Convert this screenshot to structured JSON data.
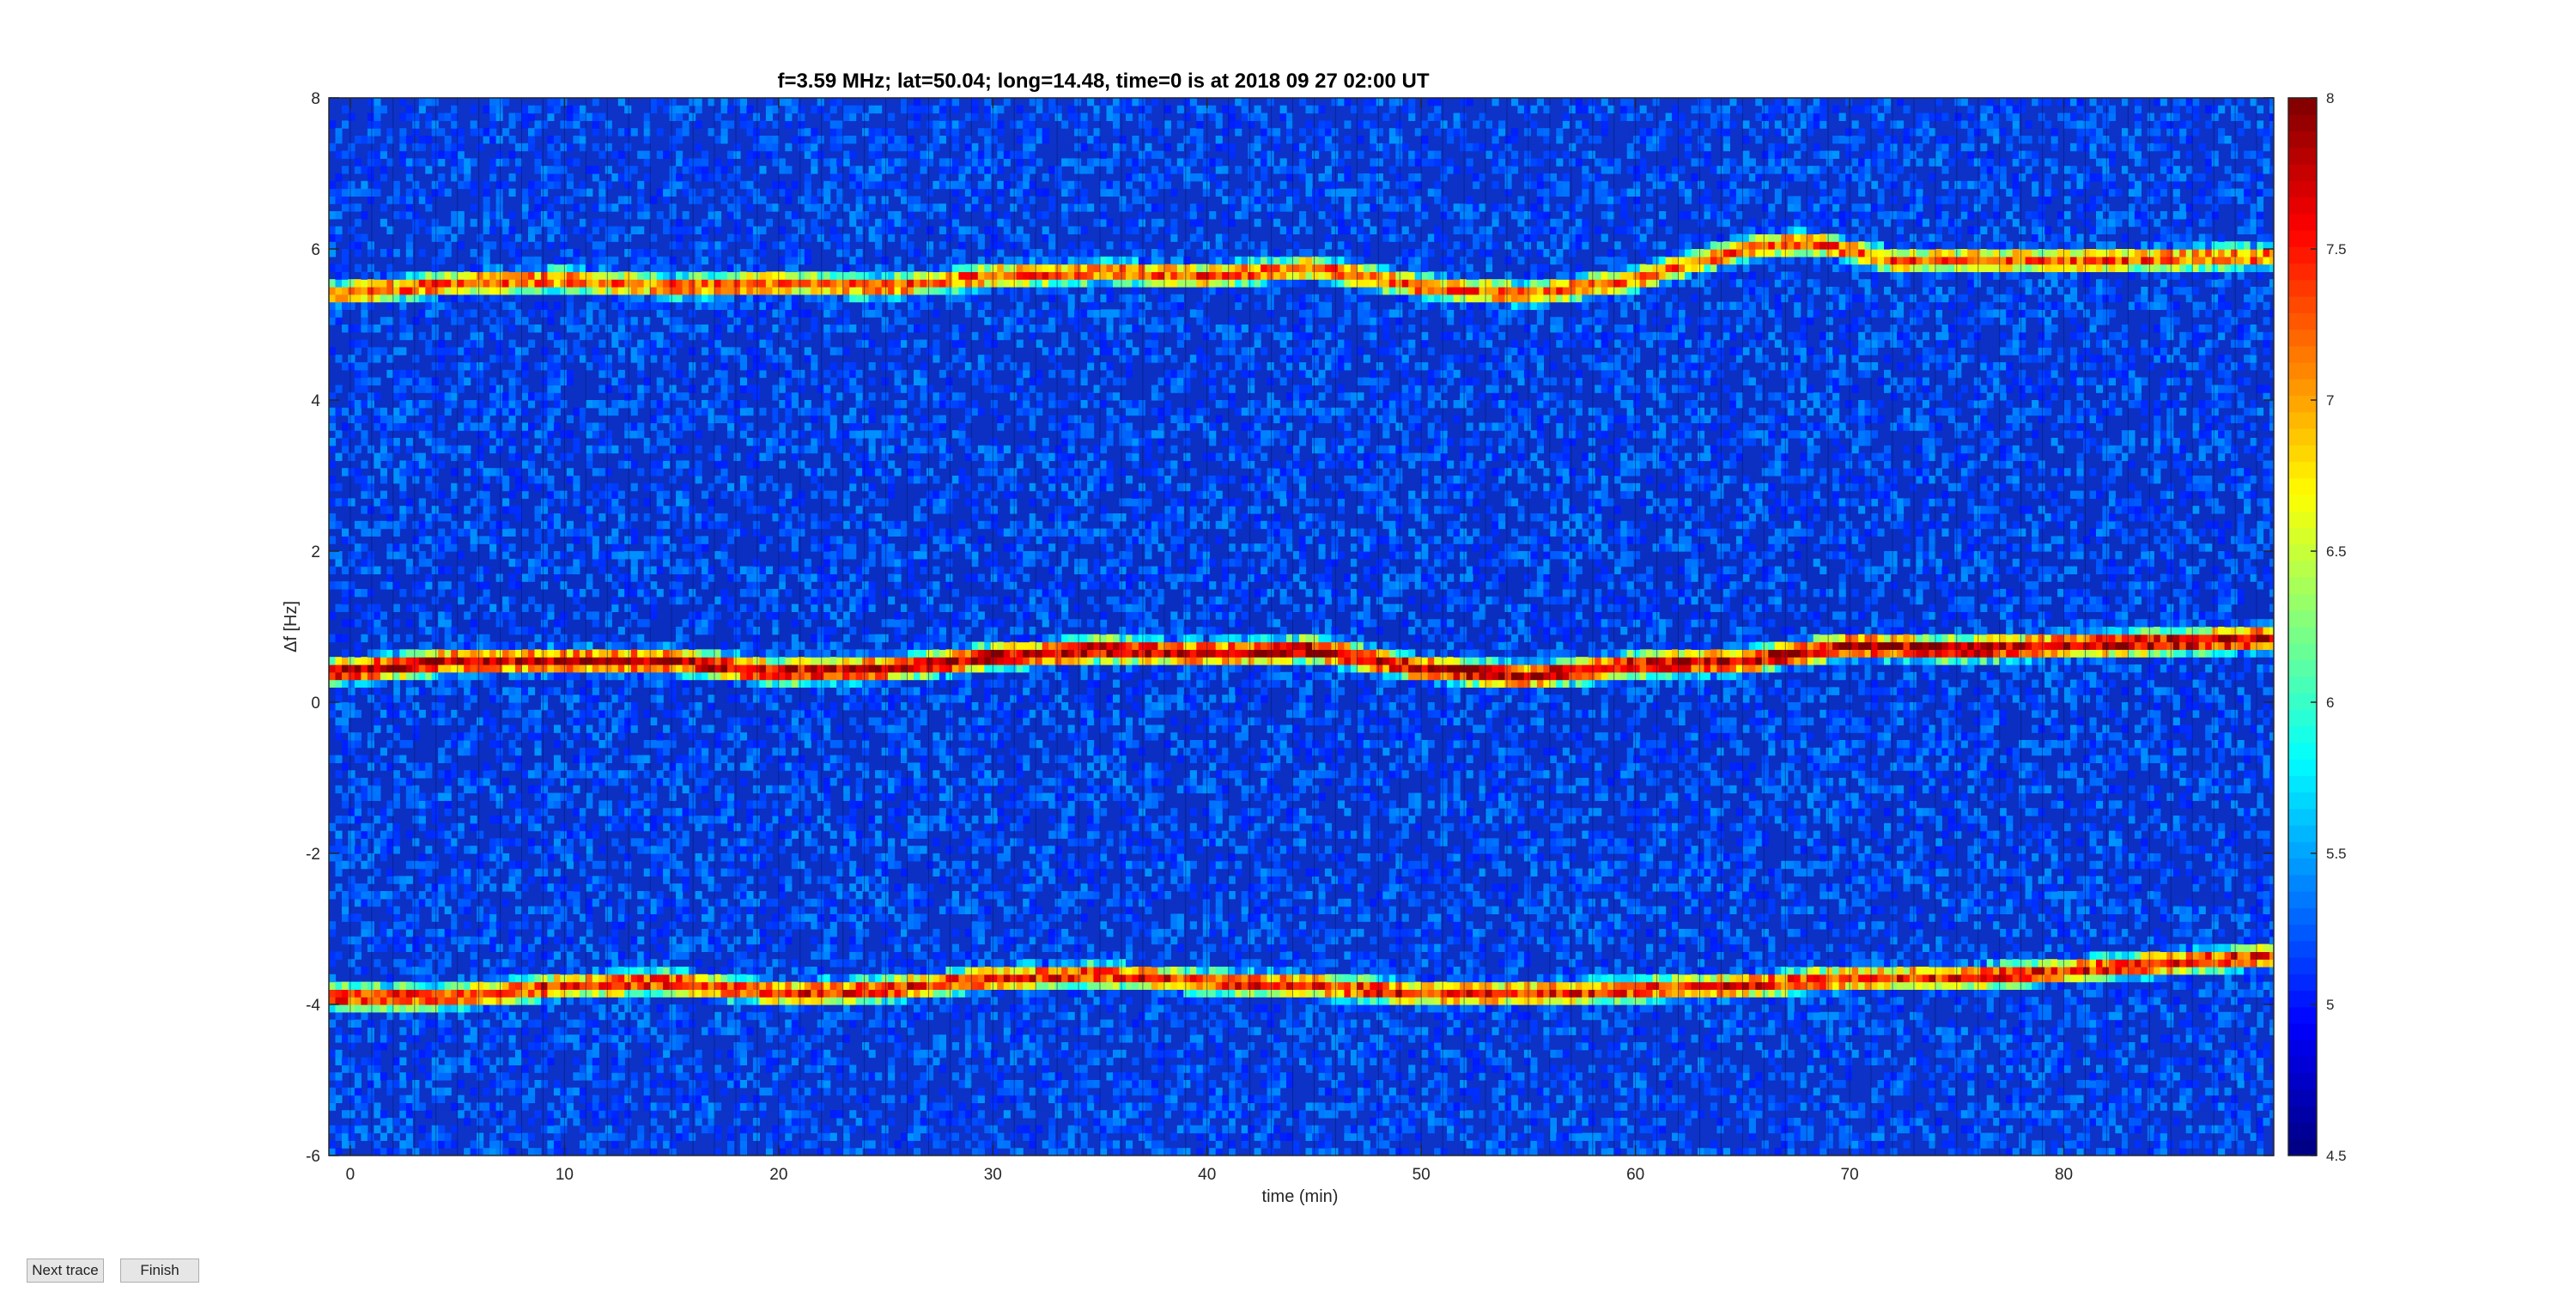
{
  "figure": {
    "buttons": {
      "next": "Next trace",
      "finish": "Finish"
    }
  },
  "chart_data": {
    "type": "heatmap",
    "title": "f=3.59 MHz;  lat=50.04; long=14.48, time=0 is at 2018 09 27 02:00 UT",
    "xlabel": "time (min)",
    "ylabel": "Δf [Hz]",
    "xlim": [
      -1,
      89.8
    ],
    "ylim": [
      -6,
      8
    ],
    "xticks": [
      0,
      10,
      20,
      30,
      40,
      50,
      60,
      70,
      80
    ],
    "yticks": [
      -6,
      -4,
      -2,
      0,
      2,
      4,
      6,
      8
    ],
    "colormap": "jet",
    "colorbar": {
      "limits": [
        4.5,
        8
      ],
      "ticks": [
        "4.5",
        "5",
        "5.5",
        "6",
        "6.5",
        "7",
        "7.5",
        "8"
      ],
      "steps": 64
    },
    "background_level": 5.0,
    "traces": [
      {
        "description_label": "upper trace",
        "peak_level": 7.3,
        "time": [
          -1,
          5,
          10,
          15,
          20,
          25,
          30,
          35,
          40,
          45,
          50,
          55,
          60,
          65,
          68,
          72,
          80,
          89.8
        ],
        "delta_f": [
          5.4,
          5.55,
          5.6,
          5.5,
          5.55,
          5.5,
          5.65,
          5.7,
          5.65,
          5.75,
          5.5,
          5.4,
          5.6,
          6.0,
          6.1,
          5.85,
          5.85,
          5.9
        ]
      },
      {
        "description_label": "middle trace",
        "peak_level": 7.8,
        "time": [
          -1,
          5,
          10,
          15,
          20,
          25,
          30,
          35,
          40,
          45,
          50,
          55,
          60,
          65,
          70,
          75,
          80,
          89.8
        ],
        "delta_f": [
          0.4,
          0.55,
          0.55,
          0.55,
          0.4,
          0.45,
          0.6,
          0.7,
          0.65,
          0.7,
          0.45,
          0.35,
          0.5,
          0.55,
          0.75,
          0.7,
          0.75,
          0.85
        ]
      },
      {
        "description_label": "lower trace",
        "peak_level": 7.5,
        "time": [
          -1,
          5,
          10,
          15,
          20,
          25,
          30,
          35,
          40,
          45,
          50,
          55,
          60,
          65,
          70,
          75,
          80,
          89.8
        ],
        "delta_f": [
          -3.9,
          -3.9,
          -3.75,
          -3.7,
          -3.85,
          -3.8,
          -3.65,
          -3.6,
          -3.7,
          -3.75,
          -3.85,
          -3.85,
          -3.8,
          -3.75,
          -3.65,
          -3.65,
          -3.55,
          -3.35
        ]
      }
    ]
  }
}
